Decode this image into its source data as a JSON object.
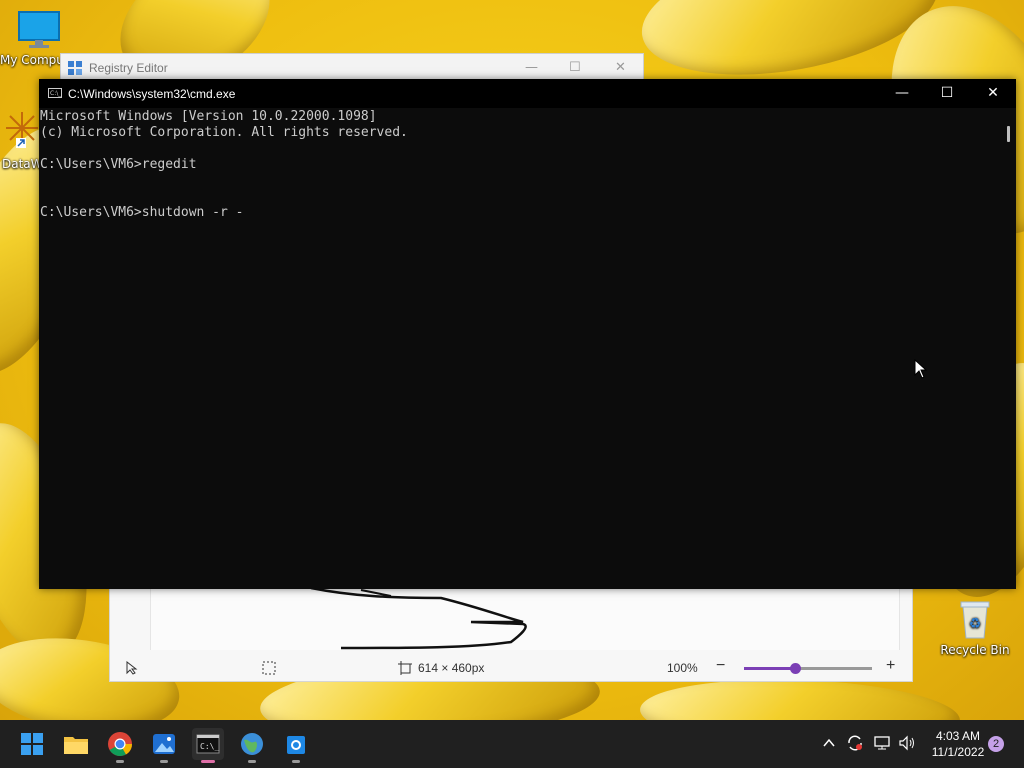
{
  "desktop": {
    "icons": [
      {
        "label": "My Computer",
        "icon": "monitor-icon"
      },
      {
        "label": "DataW",
        "icon": "shortcut-icon"
      },
      {
        "label": "Recycle Bin",
        "icon": "recycle-bin-icon"
      }
    ]
  },
  "regedit": {
    "title": "Registry Editor"
  },
  "cmd": {
    "title": "C:\\Windows\\system32\\cmd.exe",
    "app_icon_text": "C:\\_",
    "lines": [
      "Microsoft Windows [Version 10.0.22000.1098]",
      "(c) Microsoft Corporation. All rights reserved.",
      "",
      "C:\\Users\\VM6>regedit",
      "",
      "",
      "C:\\Users\\VM6>shutdown -r -"
    ]
  },
  "paint": {
    "size": "614 × 460px",
    "zoom": "100%",
    "zoom_level": 0.4
  },
  "taskbar": {
    "apps": [
      {
        "name": "start",
        "icon": "windows-start-icon"
      },
      {
        "name": "file-explorer",
        "icon": "folder-icon"
      },
      {
        "name": "chrome",
        "icon": "chrome-icon"
      },
      {
        "name": "photos",
        "icon": "photos-icon"
      },
      {
        "name": "terminal",
        "icon": "terminal-icon",
        "active": true
      },
      {
        "name": "network-app",
        "icon": "globe-icon"
      },
      {
        "name": "azure-devops",
        "icon": "gear-app-icon"
      }
    ],
    "clock_time": "4:03 AM",
    "clock_date": "11/1/2022",
    "notification_count": "2"
  },
  "colors": {
    "cmd_bg": "#0c0c0c",
    "cmd_text": "#cccccc",
    "taskbar": "#202020",
    "accent": "#7b3fb5"
  }
}
